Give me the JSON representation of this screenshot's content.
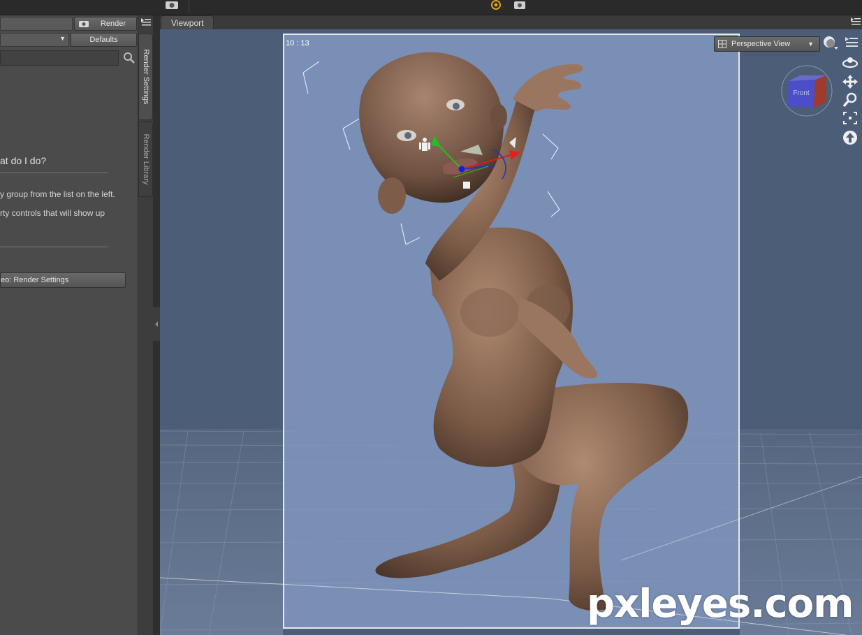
{
  "left_panel": {
    "render_button": "Render",
    "defaults_button": "Defaults",
    "dropdown_arrow": "▼",
    "help_heading": "at do I do?",
    "help_line_1": "y group from the list on the left.",
    "help_line_2": "rty controls that will show up",
    "help_link_button": "eo: Render Settings"
  },
  "vertical_tabs": [
    {
      "label": "Render Settings",
      "active": true
    },
    {
      "label": "Render Library",
      "active": false
    }
  ],
  "viewport": {
    "tab_label": "Viewport",
    "timecode": "10 : 13",
    "view_select": "Perspective View",
    "view_select_arrow": "▼",
    "view_cube_label": "Front"
  },
  "colors": {
    "viewport_bg": "#4c5d78",
    "render_area_bg": "#7a8fb5",
    "skin": "#8a6a55",
    "accent_orange": "#e0a020"
  },
  "icons": [
    "camera-icon",
    "render-camera-icon",
    "search-icon",
    "panel-menu-icon",
    "view-cube-icon",
    "orbit-icon",
    "pan-icon",
    "zoom-icon",
    "frame-icon",
    "home-icon",
    "shading-icon"
  ],
  "watermark": "pxleyes.com"
}
